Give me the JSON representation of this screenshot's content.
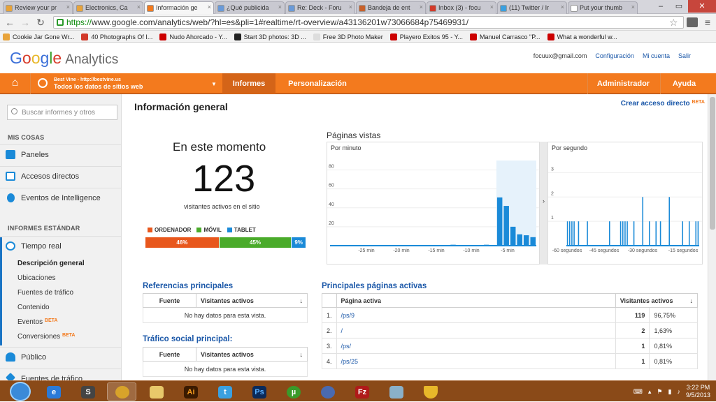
{
  "browser": {
    "tabs": [
      {
        "label": "Review your pr",
        "color": "#e8a33a"
      },
      {
        "label": "Electronics, Ca",
        "color": "#e8a33a"
      },
      {
        "label": "Información ge",
        "color": "#f37a1e",
        "active": true
      },
      {
        "label": "¿Qué publicida",
        "color": "#6a9ad8"
      },
      {
        "label": "Re: Deck - Foru",
        "color": "#6a9ad8"
      },
      {
        "label": "Bandeja de ent",
        "color": "#c8602a"
      },
      {
        "label": "Inbox (3) - focu",
        "color": "#d23a2a"
      },
      {
        "label": "(11) Twitter / Ir",
        "color": "#3aa0e0"
      },
      {
        "label": "Put your thumb",
        "color": "#ffffff"
      }
    ],
    "url_scheme": "https://",
    "url_rest": "www.google.com/analytics/web/?hl=es&pli=1#realtime/rt-overview/a43136201w73066684p75469931/",
    "bookmarks": [
      {
        "label": "Cookie Jar Gone Wr...",
        "color": "#e8a33a"
      },
      {
        "label": "40 Photographs Of I...",
        "color": "#d23a2a"
      },
      {
        "label": "Nudo Ahorcado - Y...",
        "color": "#cc0000"
      },
      {
        "label": "Start 3D photos: 3D ...",
        "color": "#222222"
      },
      {
        "label": "Free 3D Photo Maker",
        "color": "#dddddd"
      },
      {
        "label": "Playero Exitos 95 - Y...",
        "color": "#cc0000"
      },
      {
        "label": "Manuel Carrasco \"P...",
        "color": "#cc0000"
      },
      {
        "label": "What a wonderful w...",
        "color": "#cc0000"
      }
    ]
  },
  "header": {
    "logo_google": "Google",
    "logo_analytics": "Analytics",
    "email": "focuux@gmail.com",
    "config": "Configuración",
    "account": "Mi cuenta",
    "logout": "Salir"
  },
  "orange_bar": {
    "property_line1": "Best Vine - http://bestvine.us",
    "property_line2": "Todos los datos de sitios web",
    "tab_reports": "Informes",
    "tab_custom": "Personalización",
    "admin": "Administrador",
    "help": "Ayuda",
    "color": "#f37a1e"
  },
  "sidebar": {
    "search_placeholder": "Buscar informes y otros",
    "section_my": "MIS COSAS",
    "items_my": [
      "Paneles",
      "Accesos directos",
      "Eventos de Intelligence"
    ],
    "section_std": "INFORMES ESTÁNDAR",
    "realtime": "Tiempo real",
    "sub": [
      "Descripción general",
      "Ubicaciones",
      "Fuentes de tráfico",
      "Contenido",
      "Eventos",
      "Conversiones"
    ],
    "beta": "BETA",
    "public": "Público",
    "traffic": "Fuentes de tráfico"
  },
  "main": {
    "title": "Información general",
    "shortcut": "Crear acceso directo",
    "shortcut_beta": "BETA",
    "now_title": "En este momento",
    "now_value": "123",
    "now_sub": "visitantes activos en el sitio",
    "device_legend": [
      "ORDENADOR",
      "MÓVIL",
      "TABLET"
    ],
    "device_colors": [
      "#e8571c",
      "#4aab2a",
      "#1a8ad8"
    ],
    "device_pct": [
      46,
      45,
      9
    ],
    "device_labels": [
      "46%",
      "45%",
      "9%"
    ],
    "pv_title": "Páginas vistas",
    "per_minute": "Por minuto",
    "per_second": "Por segundo",
    "divider_arrow": "›"
  },
  "chart_data": [
    {
      "type": "bar",
      "title": "Por minuto",
      "ylim": [
        0,
        90
      ],
      "yticks": [
        "20",
        "40",
        "60",
        "80"
      ],
      "xticks": [
        "-25 min",
        "-20 min",
        "-15 min",
        "-10 min",
        "-5 min"
      ],
      "values": [
        0,
        0,
        0,
        0,
        0,
        0,
        0,
        0,
        0,
        0,
        0,
        0,
        0,
        0,
        0,
        0,
        0,
        0,
        1,
        0,
        0,
        0,
        0,
        1,
        0,
        51,
        42,
        20,
        12,
        11,
        9
      ]
    },
    {
      "type": "bar",
      "title": "Por segundo",
      "ylim": [
        0,
        3.5
      ],
      "yticks": [
        "1",
        "2",
        "3"
      ],
      "xticks": [
        "-60 segundos",
        "-45 segundos",
        "-30 segundos",
        "-15 segundos"
      ],
      "values": [
        1,
        1,
        1,
        1,
        0,
        1,
        0,
        0,
        0,
        1,
        0,
        0,
        0,
        0,
        0,
        0,
        0,
        0,
        0,
        1,
        0,
        0,
        0,
        0,
        1,
        1,
        1,
        1,
        0,
        0,
        1,
        0,
        0,
        0,
        2,
        0,
        0,
        1,
        0,
        0,
        1,
        0,
        1,
        0,
        0,
        0,
        2,
        0,
        0,
        0,
        0,
        0,
        1,
        0,
        0,
        1,
        0,
        0,
        1,
        1
      ]
    }
  ],
  "referrals": {
    "title": "Referencias principales",
    "col1": "Fuente",
    "col2": "Visitantes activos",
    "empty": "No hay datos para esta vista."
  },
  "social": {
    "title": "Tráfico social principal:",
    "col1": "Fuente",
    "col2": "Visitantes activos",
    "empty": "No hay datos para esta vista."
  },
  "pages": {
    "title": "Principales páginas activas",
    "col1": "Página activa",
    "col2": "Visitantes activos",
    "rows": [
      {
        "n": "1.",
        "page": "/ps/9",
        "v": "119",
        "pct": "96,75%"
      },
      {
        "n": "2.",
        "page": "/",
        "v": "2",
        "pct": "1,63%"
      },
      {
        "n": "3.",
        "page": "/ps/",
        "v": "1",
        "pct": "0,81%"
      },
      {
        "n": "4.",
        "page": "/ps/25",
        "v": "1",
        "pct": "0,81%"
      }
    ]
  },
  "taskbar": {
    "time": "3:22 PM",
    "date": "9/5/2013"
  }
}
